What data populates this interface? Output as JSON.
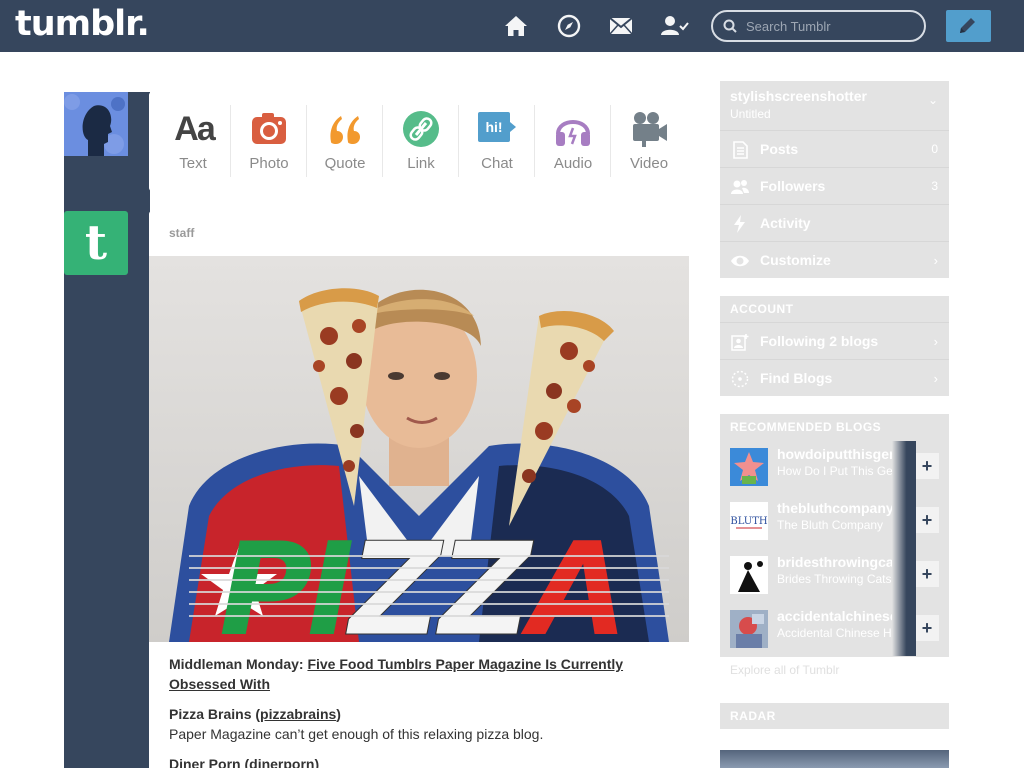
{
  "header": {
    "logo": "tumblr.",
    "search_placeholder": "Search Tumblr",
    "icons": [
      "home-icon",
      "explore-icon",
      "messages-icon",
      "account-icon",
      "compose-icon"
    ]
  },
  "post_types": [
    {
      "label": "Text",
      "icon": "text-icon",
      "color": "#444444"
    },
    {
      "label": "Photo",
      "icon": "photo-icon",
      "color": "#d95e40"
    },
    {
      "label": "Quote",
      "icon": "quote-icon",
      "color": "#f2992e"
    },
    {
      "label": "Link",
      "icon": "link-icon",
      "color": "#56bc8a"
    },
    {
      "label": "Chat",
      "icon": "chat-icon",
      "color": "#529ecc"
    },
    {
      "label": "Audio",
      "icon": "audio-icon",
      "color": "#a77dc2"
    },
    {
      "label": "Video",
      "icon": "video-icon",
      "color": "#748089"
    }
  ],
  "post": {
    "author": "staff",
    "photo_text": "PIZZA",
    "caption": {
      "intro_label": "Middleman Monday:",
      "intro_link": "Five Food Tumblrs Paper Magazine Is Currently Obsessed With",
      "item1_name": "Pizza Brains",
      "item1_open": " (",
      "item1_link": "pizzabrains",
      "item1_close": ")",
      "item1_desc": "Paper Magazine can’t get enough of this relaxing pizza blog.",
      "item2_name": "Diner Porn",
      "item2_open": " (",
      "item2_link": "dinerporn",
      "item2_close": ")"
    }
  },
  "sidebar": {
    "blog": {
      "name": "stylishscreenshotter",
      "subtitle": "Untitled",
      "items": [
        {
          "label": "Posts",
          "count": "0"
        },
        {
          "label": "Followers",
          "count": "3"
        },
        {
          "label": "Activity",
          "count": ""
        },
        {
          "label": "Customize",
          "count": "›"
        }
      ]
    },
    "account": {
      "header": "ACCOUNT",
      "items": [
        {
          "label": "Following 2 blogs"
        },
        {
          "label": "Find Blogs"
        }
      ]
    },
    "recommended": {
      "header": "RECOMMENDED BLOGS",
      "blogs": [
        {
          "name": "howdoiputthisgent",
          "subtitle": "How Do I Put This Gently"
        },
        {
          "name": "thebluthcompany",
          "subtitle": "The Bluth Company"
        },
        {
          "name": "bridesthrowingcats",
          "subtitle": "Brides Throwing Cats"
        },
        {
          "name": "accidentalchinesehipsters",
          "subtitle": "Accidental Chinese Hipsters"
        }
      ],
      "explore_link": "Explore all of Tumblr"
    },
    "radar": {
      "header": "RADAR"
    }
  },
  "colors": {
    "navy": "#36465d",
    "compose": "#529ecc",
    "panel": "#e3e3e3"
  }
}
